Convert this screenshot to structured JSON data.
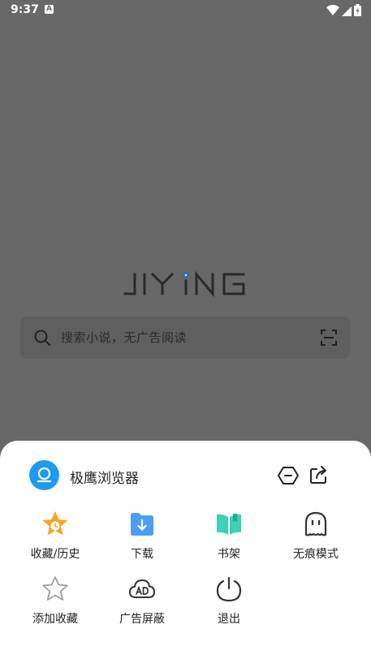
{
  "status_bar": {
    "time": "9:37",
    "notification_icon": "A"
  },
  "logo_text": "JIYiNG",
  "search": {
    "placeholder": "搜索小说，无广告阅读"
  },
  "sheet": {
    "app_name": "极鹰浏览器",
    "items": [
      {
        "label": "收藏/历史",
        "icon": "bookmark-history-icon",
        "color": "#f5a623"
      },
      {
        "label": "下载",
        "icon": "download-icon",
        "color": "#4a9ff5"
      },
      {
        "label": "书架",
        "icon": "bookshelf-icon",
        "color": "#3dd1b5"
      },
      {
        "label": "无痕模式",
        "icon": "incognito-icon",
        "color": "#333333"
      },
      {
        "label": "添加收藏",
        "icon": "star-outline-icon",
        "color": "#999999"
      },
      {
        "label": "广告屏蔽",
        "icon": "ad-block-icon",
        "color": "#333333"
      },
      {
        "label": "退出",
        "icon": "power-icon",
        "color": "#333333"
      }
    ]
  }
}
